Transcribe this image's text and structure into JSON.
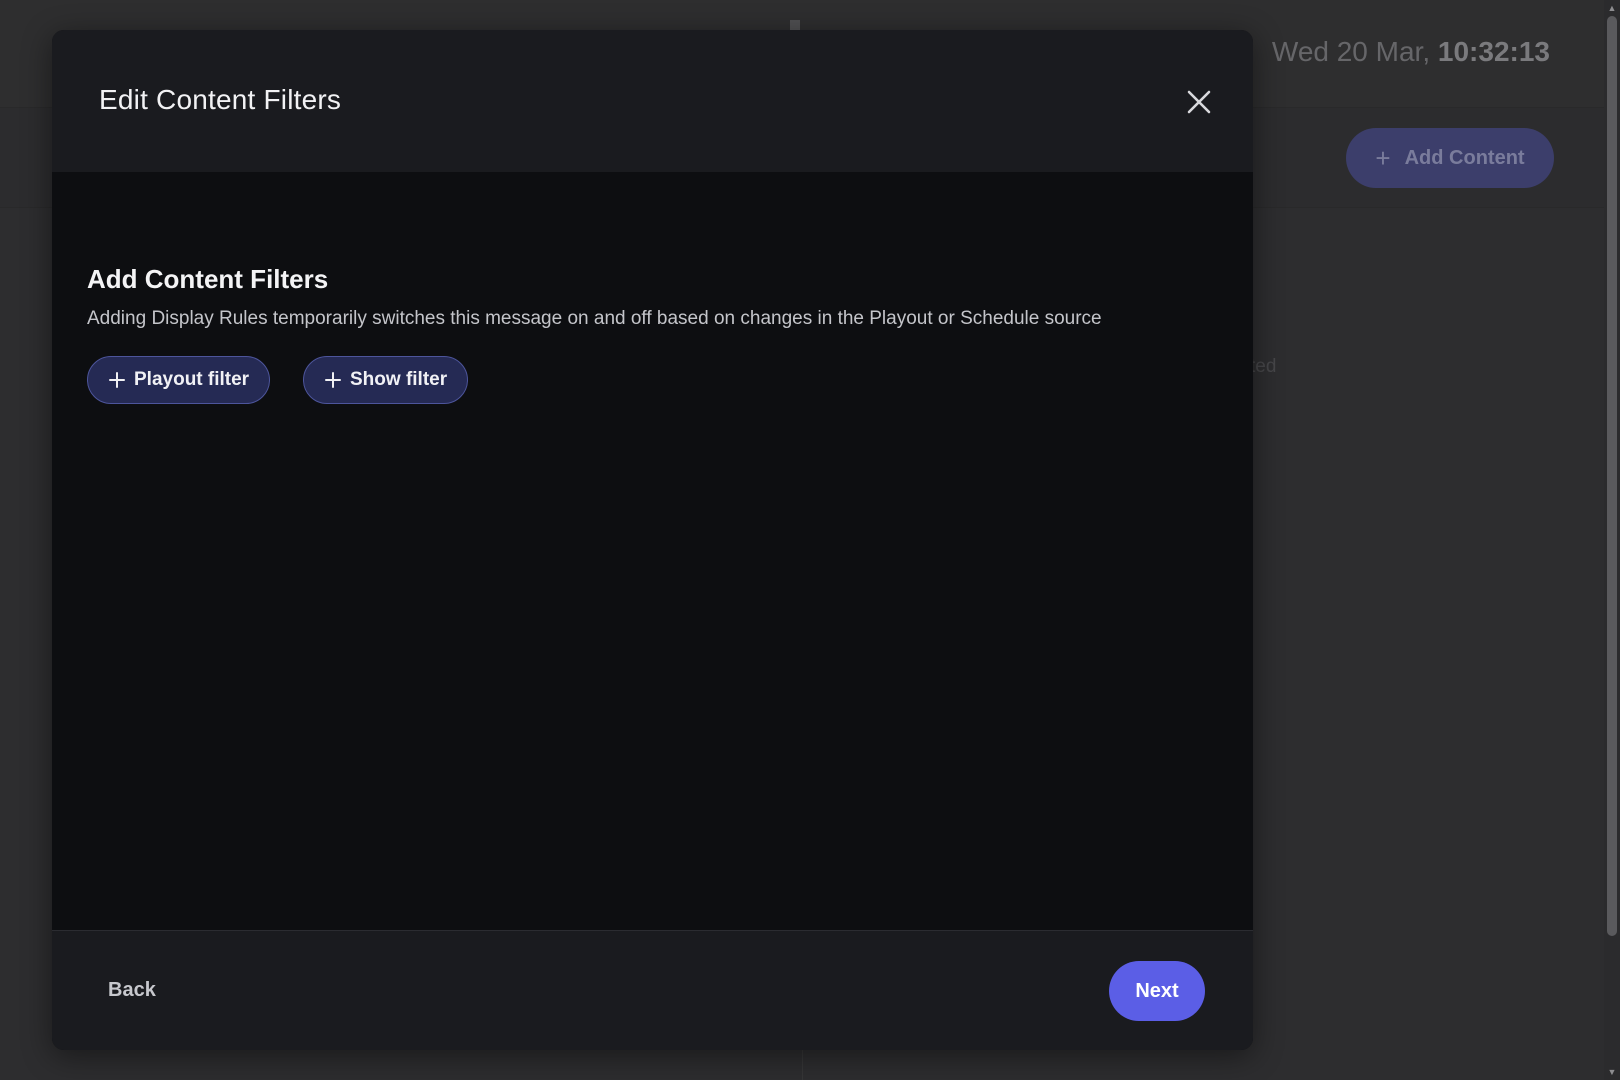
{
  "background": {
    "clock_date": "Wed 20 Mar,",
    "clock_time": "10:32:13",
    "add_content_label": "Add Content",
    "ghost_text": "ted"
  },
  "modal": {
    "title": "Edit Content Filters",
    "section_title": "Add Content Filters",
    "section_description": "Adding Display Rules temporarily switches this message on and off based on changes in the Playout or Schedule source",
    "buttons": {
      "playout_filter": "Playout filter",
      "show_filter": "Show filter",
      "back": "Back",
      "next": "Next"
    }
  },
  "colors": {
    "accent": "#5b5ee6",
    "filter_button_bg": "#252a54",
    "modal_body_bg": "#0d0e11",
    "modal_header_bg": "#1a1b1f"
  },
  "icons": {
    "close": "close-icon",
    "plus": "plus-icon"
  }
}
